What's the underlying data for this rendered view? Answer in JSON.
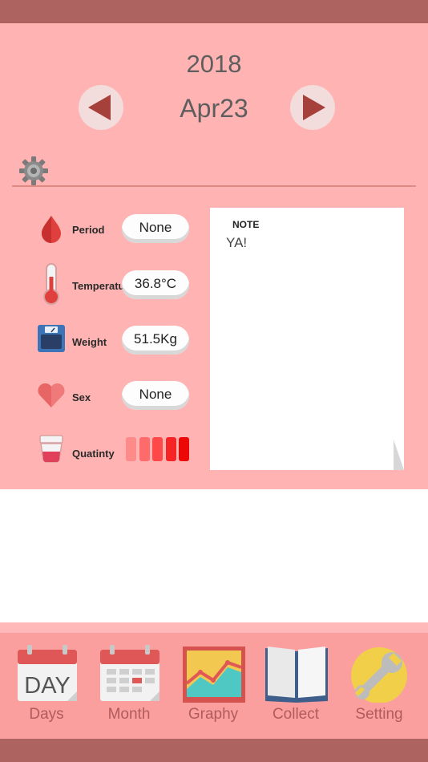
{
  "header": {
    "year": "2018",
    "date": "Apr23"
  },
  "rows": [
    {
      "label": "Period",
      "value": "None",
      "icon": "blood-drop-icon"
    },
    {
      "label": "Temperature",
      "value": "36.8°C",
      "icon": "thermometer-icon"
    },
    {
      "label": "Weight",
      "value": "51.5Kg",
      "icon": "scale-icon"
    },
    {
      "label": "Sex",
      "value": "None",
      "icon": "heart-icon"
    },
    {
      "label": "Quatinty",
      "icon": "cup-icon",
      "level": 5,
      "level_max": 5
    }
  ],
  "note": {
    "title": "NOTE",
    "text": "YA!"
  },
  "tabs": [
    {
      "label": "Days",
      "icon_text": "DAY"
    },
    {
      "label": "Month"
    },
    {
      "label": "Graphy"
    },
    {
      "label": "Collect"
    },
    {
      "label": "Setting"
    }
  ],
  "colors": {
    "accent": "#a5403a",
    "panel": "#ffb3b3",
    "status_bar": "#ad6360",
    "nav": "#fa9f9e",
    "quantity": [
      "#ff8a8a",
      "#ff6a6a",
      "#ff4848",
      "#f62424",
      "#ee0707"
    ]
  }
}
